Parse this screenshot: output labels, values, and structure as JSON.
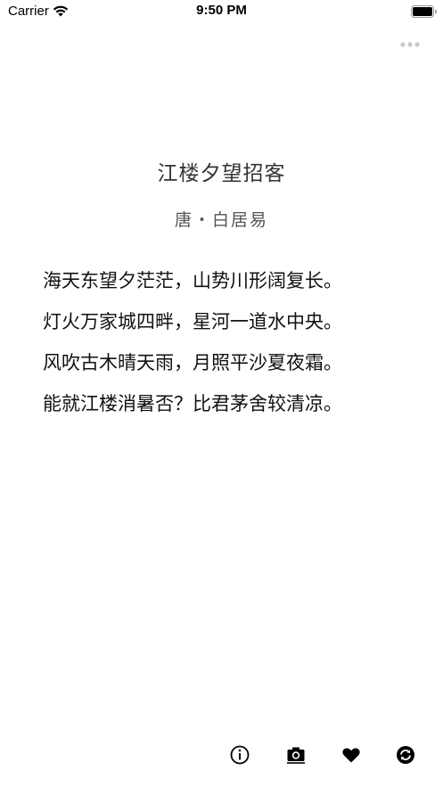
{
  "status_bar": {
    "carrier": "Carrier",
    "time": "9:50 PM",
    "icons": [
      "wifi-icon",
      "battery-icon"
    ]
  },
  "header": {
    "more_icon": "more-dots-icon",
    "more_color": "#c7c7cc"
  },
  "poem": {
    "title": "江楼夕望招客",
    "author": "唐・白居易",
    "lines": [
      "海天东望夕茫茫，山势川形阔复长。",
      "灯火万家城四畔，星河一道水中央。",
      "风吹古木晴天雨，月照平沙夏夜霜。",
      "能就江楼消暑否？比君茅舍较清凉。"
    ]
  },
  "toolbar": {
    "buttons": [
      {
        "icon": "info-icon"
      },
      {
        "icon": "camera-icon"
      },
      {
        "icon": "heart-icon"
      },
      {
        "icon": "refresh-icon"
      }
    ]
  }
}
